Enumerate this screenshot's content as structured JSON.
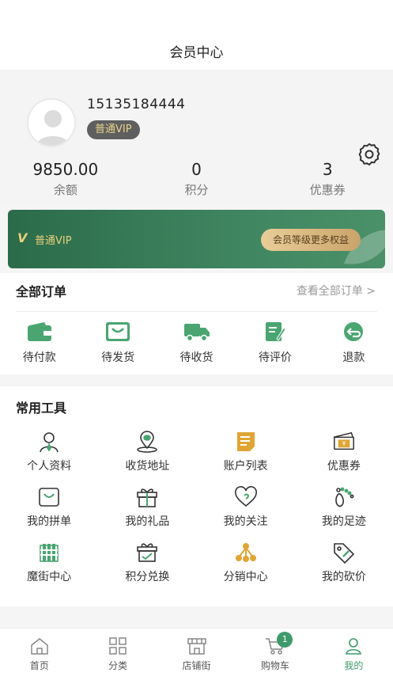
{
  "header": {
    "title": "会员中心"
  },
  "profile": {
    "phone": "15135184444",
    "vip_level": "普通VIP",
    "stats": [
      {
        "value": "9850.00",
        "label": "余额"
      },
      {
        "value": "0",
        "label": "积分"
      },
      {
        "value": "3",
        "label": "优惠券"
      }
    ]
  },
  "vip_card": {
    "badge": "V",
    "level": "普通VIP",
    "button": "会员等级更多权益"
  },
  "orders": {
    "title": "全部订单",
    "view_all": "查看全部订单 >",
    "items": [
      {
        "label": "待付款",
        "icon": "wallet-icon"
      },
      {
        "label": "待发货",
        "icon": "shopping-bag-icon"
      },
      {
        "label": "待收货",
        "icon": "truck-icon"
      },
      {
        "label": "待评价",
        "icon": "edit-doc-icon"
      },
      {
        "label": "退款",
        "icon": "refund-icon"
      }
    ]
  },
  "tools": {
    "title": "常用工具",
    "items": [
      {
        "label": "个人资料",
        "icon": "user-icon"
      },
      {
        "label": "收货地址",
        "icon": "location-icon"
      },
      {
        "label": "账户列表",
        "icon": "account-list-icon"
      },
      {
        "label": "优惠券",
        "icon": "coupon-icon"
      },
      {
        "label": "我的拼单",
        "icon": "group-order-icon"
      },
      {
        "label": "我的礼品",
        "icon": "gift-icon"
      },
      {
        "label": "我的关注",
        "icon": "heart-icon"
      },
      {
        "label": "我的足迹",
        "icon": "footprint-icon"
      },
      {
        "label": "魔街中心",
        "icon": "building-icon"
      },
      {
        "label": "积分兑换",
        "icon": "points-exchange-icon"
      },
      {
        "label": "分销中心",
        "icon": "distribution-icon"
      },
      {
        "label": "我的砍价",
        "icon": "bargain-icon"
      }
    ]
  },
  "tabbar": {
    "items": [
      {
        "label": "首页",
        "icon": "home-icon"
      },
      {
        "label": "分类",
        "icon": "category-icon"
      },
      {
        "label": "店铺街",
        "icon": "store-icon"
      },
      {
        "label": "购物车",
        "icon": "cart-icon",
        "badge": "1"
      },
      {
        "label": "我的",
        "icon": "me-icon",
        "active": true
      }
    ]
  },
  "colors": {
    "accent": "#3f9a6b",
    "vip_gold": "#e8d07a",
    "card_green": "#2b6b4a",
    "tool_green": "#4aa571",
    "tool_gold": "#e0a534"
  }
}
